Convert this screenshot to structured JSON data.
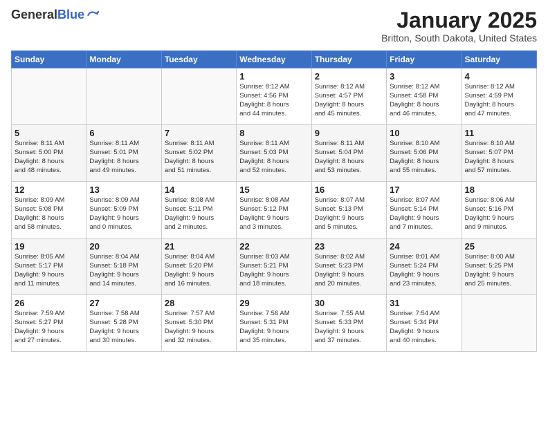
{
  "header": {
    "logo_general": "General",
    "logo_blue": "Blue",
    "month_title": "January 2025",
    "location": "Britton, South Dakota, United States"
  },
  "weekdays": [
    "Sunday",
    "Monday",
    "Tuesday",
    "Wednesday",
    "Thursday",
    "Friday",
    "Saturday"
  ],
  "weeks": [
    [
      {
        "day": "",
        "info": ""
      },
      {
        "day": "",
        "info": ""
      },
      {
        "day": "",
        "info": ""
      },
      {
        "day": "1",
        "info": "Sunrise: 8:12 AM\nSunset: 4:56 PM\nDaylight: 8 hours\nand 44 minutes."
      },
      {
        "day": "2",
        "info": "Sunrise: 8:12 AM\nSunset: 4:57 PM\nDaylight: 8 hours\nand 45 minutes."
      },
      {
        "day": "3",
        "info": "Sunrise: 8:12 AM\nSunset: 4:58 PM\nDaylight: 8 hours\nand 46 minutes."
      },
      {
        "day": "4",
        "info": "Sunrise: 8:12 AM\nSunset: 4:59 PM\nDaylight: 8 hours\nand 47 minutes."
      }
    ],
    [
      {
        "day": "5",
        "info": "Sunrise: 8:11 AM\nSunset: 5:00 PM\nDaylight: 8 hours\nand 48 minutes."
      },
      {
        "day": "6",
        "info": "Sunrise: 8:11 AM\nSunset: 5:01 PM\nDaylight: 8 hours\nand 49 minutes."
      },
      {
        "day": "7",
        "info": "Sunrise: 8:11 AM\nSunset: 5:02 PM\nDaylight: 8 hours\nand 51 minutes."
      },
      {
        "day": "8",
        "info": "Sunrise: 8:11 AM\nSunset: 5:03 PM\nDaylight: 8 hours\nand 52 minutes."
      },
      {
        "day": "9",
        "info": "Sunrise: 8:11 AM\nSunset: 5:04 PM\nDaylight: 8 hours\nand 53 minutes."
      },
      {
        "day": "10",
        "info": "Sunrise: 8:10 AM\nSunset: 5:06 PM\nDaylight: 8 hours\nand 55 minutes."
      },
      {
        "day": "11",
        "info": "Sunrise: 8:10 AM\nSunset: 5:07 PM\nDaylight: 8 hours\nand 57 minutes."
      }
    ],
    [
      {
        "day": "12",
        "info": "Sunrise: 8:09 AM\nSunset: 5:08 PM\nDaylight: 8 hours\nand 58 minutes."
      },
      {
        "day": "13",
        "info": "Sunrise: 8:09 AM\nSunset: 5:09 PM\nDaylight: 9 hours\nand 0 minutes."
      },
      {
        "day": "14",
        "info": "Sunrise: 8:08 AM\nSunset: 5:11 PM\nDaylight: 9 hours\nand 2 minutes."
      },
      {
        "day": "15",
        "info": "Sunrise: 8:08 AM\nSunset: 5:12 PM\nDaylight: 9 hours\nand 3 minutes."
      },
      {
        "day": "16",
        "info": "Sunrise: 8:07 AM\nSunset: 5:13 PM\nDaylight: 9 hours\nand 5 minutes."
      },
      {
        "day": "17",
        "info": "Sunrise: 8:07 AM\nSunset: 5:14 PM\nDaylight: 9 hours\nand 7 minutes."
      },
      {
        "day": "18",
        "info": "Sunrise: 8:06 AM\nSunset: 5:16 PM\nDaylight: 9 hours\nand 9 minutes."
      }
    ],
    [
      {
        "day": "19",
        "info": "Sunrise: 8:05 AM\nSunset: 5:17 PM\nDaylight: 9 hours\nand 11 minutes."
      },
      {
        "day": "20",
        "info": "Sunrise: 8:04 AM\nSunset: 5:18 PM\nDaylight: 9 hours\nand 14 minutes."
      },
      {
        "day": "21",
        "info": "Sunrise: 8:04 AM\nSunset: 5:20 PM\nDaylight: 9 hours\nand 16 minutes."
      },
      {
        "day": "22",
        "info": "Sunrise: 8:03 AM\nSunset: 5:21 PM\nDaylight: 9 hours\nand 18 minutes."
      },
      {
        "day": "23",
        "info": "Sunrise: 8:02 AM\nSunset: 5:23 PM\nDaylight: 9 hours\nand 20 minutes."
      },
      {
        "day": "24",
        "info": "Sunrise: 8:01 AM\nSunset: 5:24 PM\nDaylight: 9 hours\nand 23 minutes."
      },
      {
        "day": "25",
        "info": "Sunrise: 8:00 AM\nSunset: 5:25 PM\nDaylight: 9 hours\nand 25 minutes."
      }
    ],
    [
      {
        "day": "26",
        "info": "Sunrise: 7:59 AM\nSunset: 5:27 PM\nDaylight: 9 hours\nand 27 minutes."
      },
      {
        "day": "27",
        "info": "Sunrise: 7:58 AM\nSunset: 5:28 PM\nDaylight: 9 hours\nand 30 minutes."
      },
      {
        "day": "28",
        "info": "Sunrise: 7:57 AM\nSunset: 5:30 PM\nDaylight: 9 hours\nand 32 minutes."
      },
      {
        "day": "29",
        "info": "Sunrise: 7:56 AM\nSunset: 5:31 PM\nDaylight: 9 hours\nand 35 minutes."
      },
      {
        "day": "30",
        "info": "Sunrise: 7:55 AM\nSunset: 5:33 PM\nDaylight: 9 hours\nand 37 minutes."
      },
      {
        "day": "31",
        "info": "Sunrise: 7:54 AM\nSunset: 5:34 PM\nDaylight: 9 hours\nand 40 minutes."
      },
      {
        "day": "",
        "info": ""
      }
    ]
  ]
}
